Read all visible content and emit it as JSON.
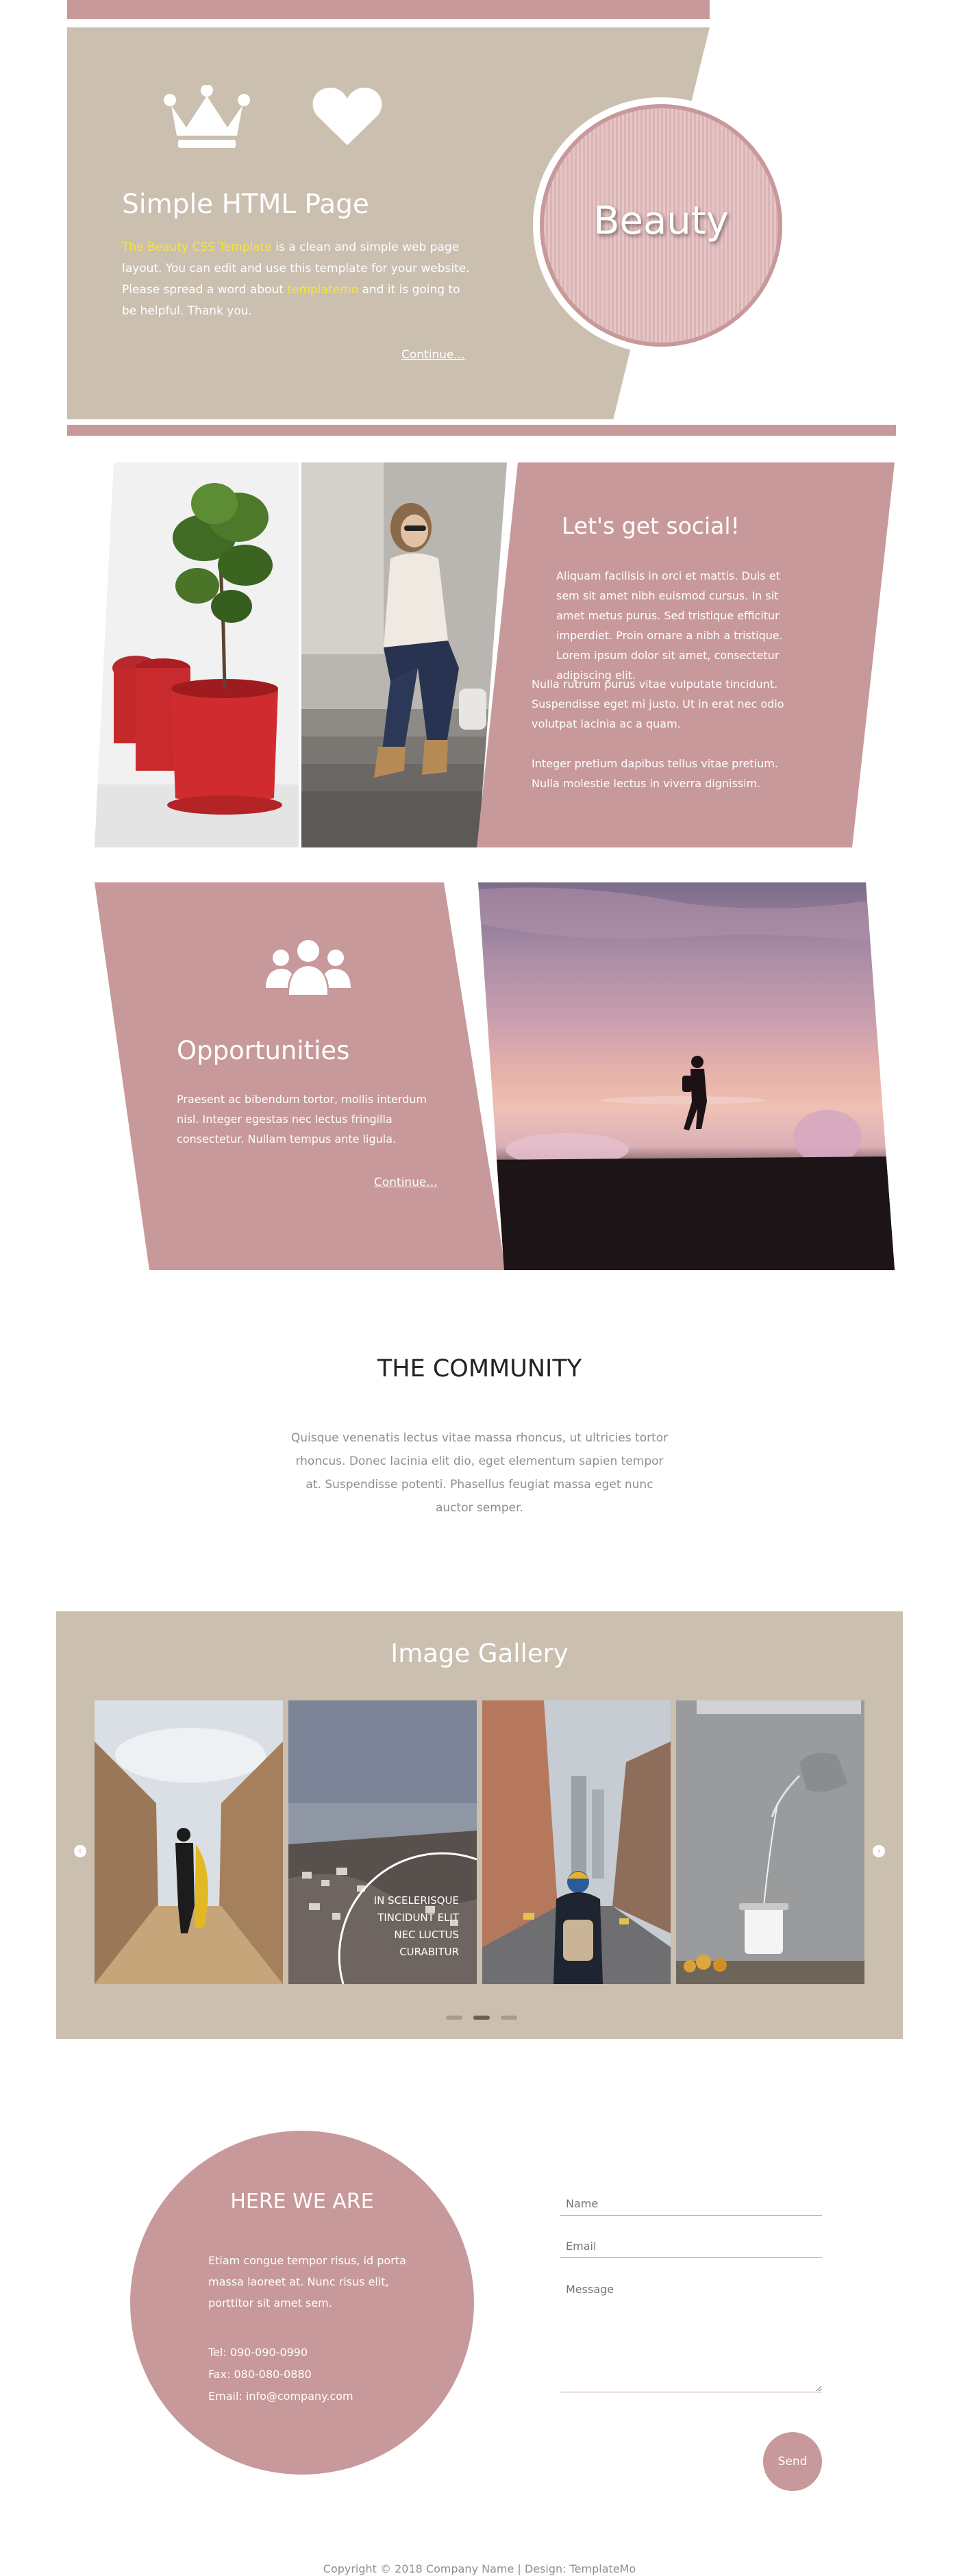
{
  "hero": {
    "title": "Simple HTML Page",
    "text_highlight": "The Beauty CSS Template",
    "text_part1": " is a clean and simple web page layout. You can edit and use this template for your website. Please spread a word about ",
    "text_link": "templatemo",
    "text_part2": " and it is going to be helpful. Thank you.",
    "continue_label": "Continue...",
    "icons": [
      "crown-icon",
      "heart-icon"
    ],
    "badge_text": "Beauty"
  },
  "social": {
    "title": "Let's get social!",
    "paragraphs": [
      "Aliquam facilisis in orci et mattis. Duis et sem sit amet nibh euismod cursus. In sit amet metus purus. Sed tristique efficitur imperdiet. Proin ornare a nibh a tristique. Lorem ipsum dolor sit amet, consectetur adipiscing elit.",
      "Nulla rutrum purus vitae vulputate tincidunt. Suspendisse eget mi justo. Ut in erat nec odio volutpat lacinia ac a quam.",
      "Integer pretium dapibus tellus vitae pretium. Nulla molestie lectus in viverra dignissim."
    ]
  },
  "opportunities": {
    "icon": "users-icon",
    "title": "Opportunities",
    "text": "Praesent ac bibendum tortor, mollis interdum nisl. Integer egestas nec lectus fringilla consectetur. Nullam tempus ante ligula.",
    "continue_label": "Continue..."
  },
  "community": {
    "title": "THE COMMUNITY",
    "text": "Quisque venenatis lectus vitae massa rhoncus, ut ultricies tortor rhoncus. Donec lacinia elit dio, eget elementum sapien tempor at. Suspendisse potenti. Phasellus feugiat massa eget nunc auctor semper."
  },
  "gallery": {
    "title": "Image Gallery",
    "caption_lines": [
      "IN SCELERISQUE",
      "TINCIDUNT ELIT",
      "NEC LUCTUS",
      "CURABITUR"
    ],
    "prev_label": "‹",
    "next_label": "›",
    "active_dot": 1,
    "dot_count": 3
  },
  "contact": {
    "title": "HERE WE ARE",
    "text": "Etiam congue tempor risus, id porta massa laoreet at. Nunc risus elit, porttitor sit amet sem.",
    "tel": "Tel: 090-090-0990",
    "fax": "Fax: 080-080-0880",
    "email": "Email: info@company.com",
    "form": {
      "name_placeholder": "Name",
      "email_placeholder": "Email",
      "message_placeholder": "Message",
      "send_label": "Send"
    }
  },
  "footer": {
    "text": "Copyright © 2018 Company Name | Design: TemplateMo"
  },
  "colors": {
    "pink": "#c8999a",
    "tan": "#cbbfb0",
    "highlight": "#f2e73a"
  }
}
